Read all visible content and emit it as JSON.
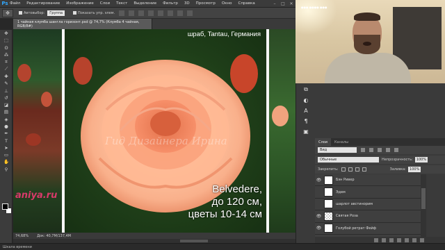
{
  "menubar": {
    "logo": "Ps",
    "items": [
      "Файл",
      "Редактирование",
      "Изображение",
      "Слои",
      "Текст",
      "Выделение",
      "Фильтр",
      "3D",
      "Просмотр",
      "Окно",
      "Справка"
    ],
    "window_controls": [
      "–",
      "□",
      "✕"
    ]
  },
  "options_bar": {
    "auto_select_label": "Автовыбор:",
    "auto_select_value": "Группа",
    "show_transform_label": "Показать упр. элем."
  },
  "document": {
    "tab_title": "1 чайная клумба шангла горизонт.psd @ 74,7% (Клумба 4 чайная, RGB/8#)",
    "caption_top": "шраб, Tantau, Германия",
    "caption_bottom_lines": [
      "Belvedere,",
      "до 120 см,",
      "цветы 10-14 см"
    ],
    "watermark": "Гид Дизайнера Ирина",
    "site_text": "aniya.ru"
  },
  "status_bar": {
    "zoom": "74,68%",
    "doc_size": "Док: 40,7M/137,4M"
  },
  "taskbar": {
    "label": "Шкала времени"
  },
  "webcam": {
    "label": "●●● ●●●● ●●●"
  },
  "layers_panel": {
    "tabs": [
      "Слои",
      "Каналы"
    ],
    "active_tab": "Слои",
    "filter_value": "Вид",
    "blend_mode": "Обычные",
    "opacity_label": "Непрозрачность:",
    "opacity_value": "100%",
    "lock_label": "Закрепить:",
    "fill_label": "Заливка:",
    "fill_value": "100%",
    "layers": [
      {
        "name": "Бэн Ривер",
        "visible": true,
        "thumb": "white"
      },
      {
        "name": "Эдем",
        "visible": false,
        "thumb": "white"
      },
      {
        "name": "шарлот австинорим",
        "visible": false,
        "thumb": "white"
      },
      {
        "name": "Святая Роза",
        "visible": true,
        "thumb": "checker"
      },
      {
        "name": "Голубой ретрат Фейф",
        "visible": true,
        "thumb": "white"
      }
    ]
  },
  "colors": {
    "rose_light": "#ffc3a0",
    "rose_mid": "#f7906a",
    "site_text": "#d83a6a",
    "ps_blue": "#31a8ff"
  }
}
